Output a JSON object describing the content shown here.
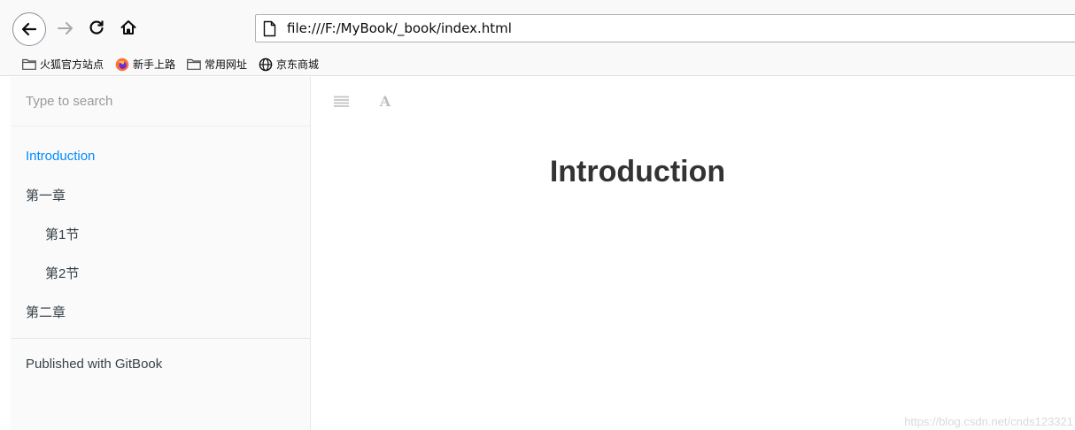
{
  "browser": {
    "url": "file:///F:/MyBook/_book/index.html",
    "bookmarks": [
      {
        "label": "火狐官方站点",
        "icon": "folder-icon"
      },
      {
        "label": "新手上路",
        "icon": "firefox-icon"
      },
      {
        "label": "常用网址",
        "icon": "folder-icon"
      },
      {
        "label": "京东商城",
        "icon": "globe-icon"
      }
    ]
  },
  "sidebar": {
    "search_placeholder": "Type to search",
    "items": [
      {
        "label": "Introduction",
        "active": true,
        "level": 1
      },
      {
        "label": "第一章",
        "active": false,
        "level": 1
      },
      {
        "label": "第1节",
        "active": false,
        "level": 2
      },
      {
        "label": "第2节",
        "active": false,
        "level": 2
      },
      {
        "label": "第二章",
        "active": false,
        "level": 1
      }
    ],
    "published": "Published with GitBook"
  },
  "header": {
    "toggle_icon": "hamburger-icon",
    "font_icon": "font-settings-icon",
    "font_glyph": "A"
  },
  "page": {
    "title": "Introduction"
  },
  "watermark": "https://blog.csdn.net/cnds123321",
  "colors": {
    "active_link": "#008cff",
    "sidebar_bg": "#fafafa",
    "chrome_bg": "#f9f9fa"
  }
}
